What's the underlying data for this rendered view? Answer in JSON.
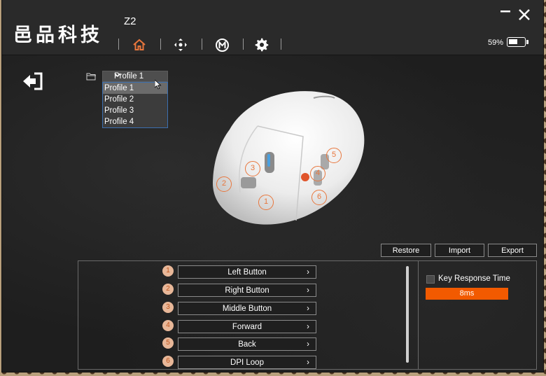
{
  "app": {
    "logo": "邑品科技",
    "model": "Z2"
  },
  "nav": {
    "icons": [
      "home-icon",
      "dpad-icon",
      "macro-icon",
      "settings-icon"
    ],
    "active_color": "#e8763c"
  },
  "battery": {
    "percent_label": "59%",
    "level": 0.59
  },
  "profile": {
    "selected": "Profile 1",
    "options": [
      "Profile 1",
      "Profile 2",
      "Profile 3",
      "Profile 4"
    ]
  },
  "mouse_markers": [
    "1",
    "2",
    "3",
    "4",
    "5",
    "6"
  ],
  "toolbar": {
    "restore": "Restore",
    "import": "Import",
    "export": "Export"
  },
  "buttons": [
    {
      "num": "1",
      "label": "Left Button"
    },
    {
      "num": "2",
      "label": "Right Button"
    },
    {
      "num": "3",
      "label": "Middle Button"
    },
    {
      "num": "4",
      "label": "Forward"
    },
    {
      "num": "5",
      "label": "Back"
    },
    {
      "num": "6",
      "label": "DPI Loop"
    }
  ],
  "key_response": {
    "label": "Key Response Time",
    "value": "8ms",
    "accent": "#f25a00"
  }
}
